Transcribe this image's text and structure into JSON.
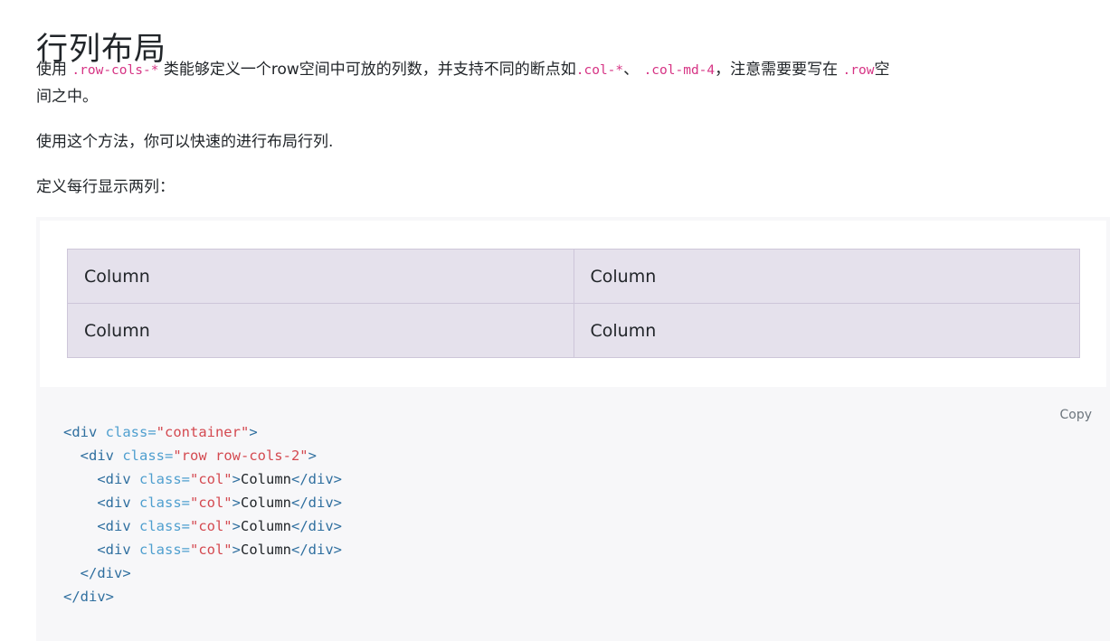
{
  "heading": "行列布局",
  "intro": {
    "part1": "使用 ",
    "code1": ".row-cols-*",
    "part2": " 类能够定义一个row空间中可放的列数，并支持不同的断点如",
    "code2": ".col-*",
    "part3": "、 ",
    "code3": ".col-md-4",
    "part4": "，注意需要要写在 ",
    "code4": ".row",
    "part5": "空间之中。"
  },
  "para2": "使用这个方法，你可以快速的进行布局行列.",
  "para3": "定义每行显示两列：",
  "example": {
    "columns": [
      "Column",
      "Column",
      "Column",
      "Column"
    ]
  },
  "code": {
    "copy_label": "Copy",
    "lines": [
      {
        "indent": "",
        "open": "<div",
        "attr": " class=",
        "value": "\"container\"",
        "close": ">",
        "text": "",
        "end": ""
      },
      {
        "indent": "  ",
        "open": "<div",
        "attr": " class=",
        "value": "\"row row-cols-2\"",
        "close": ">",
        "text": "",
        "end": ""
      },
      {
        "indent": "    ",
        "open": "<div",
        "attr": " class=",
        "value": "\"col\"",
        "close": ">",
        "text": "Column",
        "end": "</div>"
      },
      {
        "indent": "    ",
        "open": "<div",
        "attr": " class=",
        "value": "\"col\"",
        "close": ">",
        "text": "Column",
        "end": "</div>"
      },
      {
        "indent": "    ",
        "open": "<div",
        "attr": " class=",
        "value": "\"col\"",
        "close": ">",
        "text": "Column",
        "end": "</div>"
      },
      {
        "indent": "    ",
        "open": "<div",
        "attr": " class=",
        "value": "\"col\"",
        "close": ">",
        "text": "Column",
        "end": "</div>"
      },
      {
        "indent": "  ",
        "open": "</div>",
        "attr": "",
        "value": "",
        "close": "",
        "text": "",
        "end": ""
      },
      {
        "indent": "",
        "open": "</div>",
        "attr": "",
        "value": "",
        "close": "",
        "text": "",
        "end": ""
      }
    ]
  }
}
